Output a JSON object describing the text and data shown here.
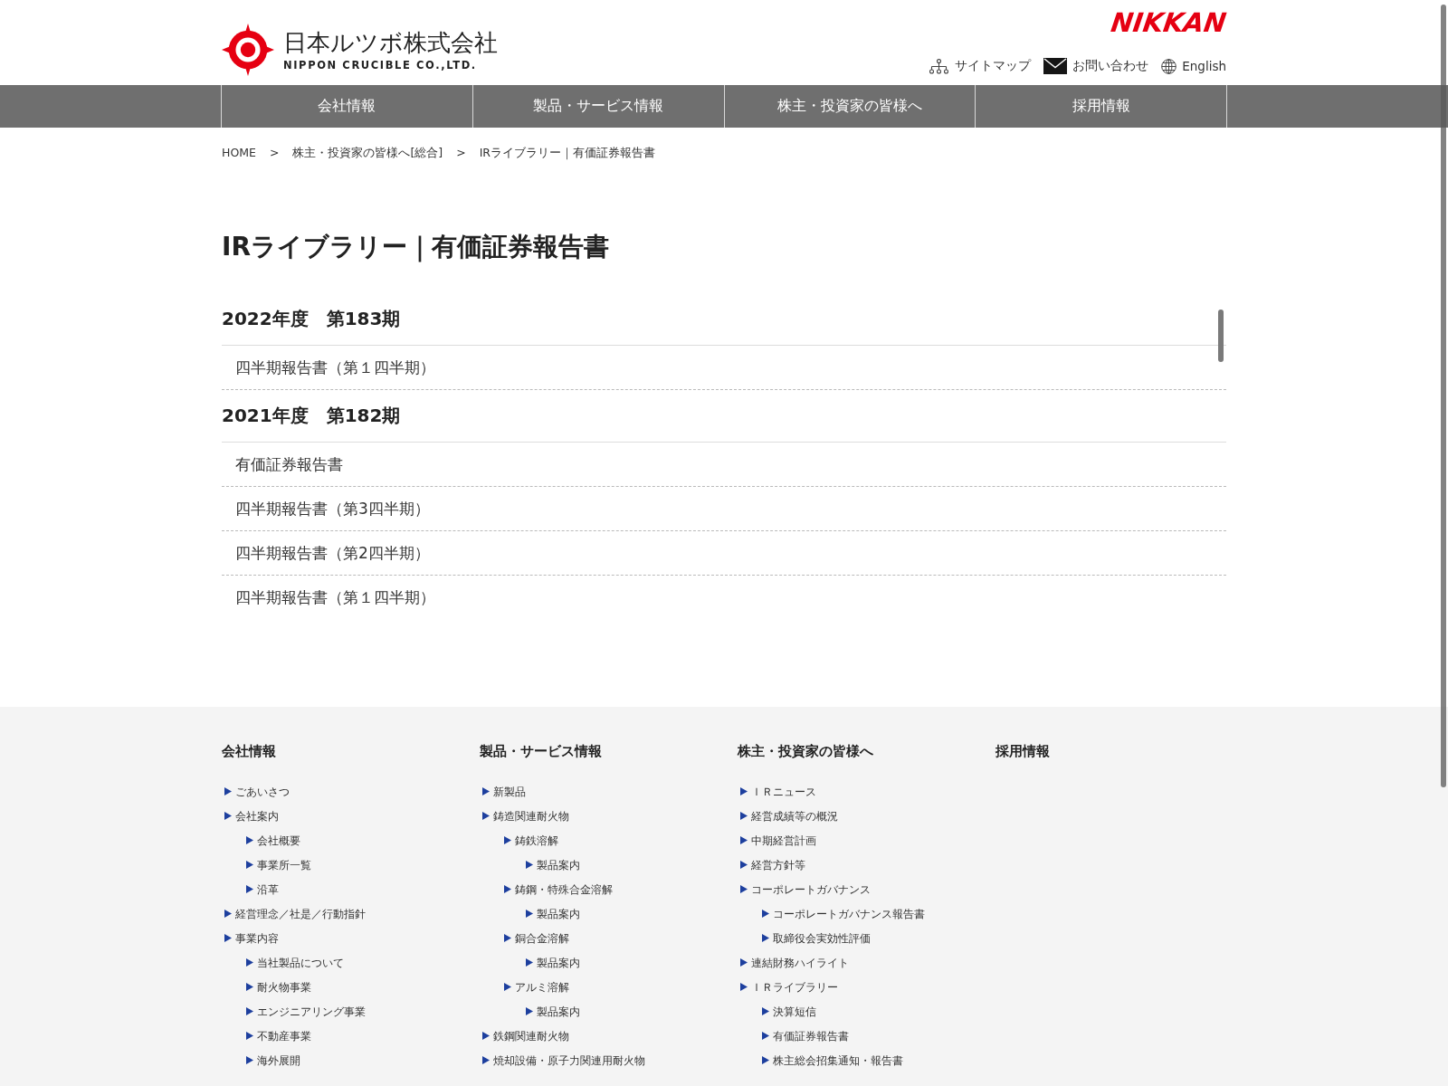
{
  "header": {
    "logo": {
      "name_ja": "日本ルツボ株式会社",
      "name_en": "NIPPON CRUCIBLE CO.,LTD."
    },
    "brand_mark": "NIKKAN",
    "utility_links": [
      {
        "kind": "sitemap",
        "label": "サイトマップ"
      },
      {
        "kind": "mail",
        "label": "お問い合わせ"
      },
      {
        "kind": "globe",
        "label": "English"
      }
    ]
  },
  "nav": [
    {
      "label": "会社情報"
    },
    {
      "label": "製品・サービス情報"
    },
    {
      "label": "株主・投資家の皆様へ"
    },
    {
      "label": "採用情報"
    }
  ],
  "breadcrumb": {
    "separator": ">",
    "items": [
      "HOME",
      "株主・投資家の皆様へ[総合]",
      "IRライブラリー｜有価証券報告書"
    ]
  },
  "page_title": "IRライブラリー｜有価証券報告書",
  "sections": [
    {
      "heading": "2022年度　第183期",
      "documents": [
        "四半期報告書（第１四半期）"
      ]
    },
    {
      "heading": "2021年度　第182期",
      "documents": [
        "有価証券報告書",
        "四半期報告書（第3四半期）",
        "四半期報告書（第2四半期）",
        "四半期報告書（第１四半期）"
      ]
    }
  ],
  "footer": {
    "columns": [
      {
        "heading": "会社情報",
        "links": [
          {
            "label": "ごあいさつ"
          },
          {
            "label": "会社案内",
            "children": [
              {
                "label": "会社概要"
              },
              {
                "label": "事業所一覧"
              },
              {
                "label": "沿革"
              }
            ]
          },
          {
            "label": "経営理念／社是／行動指針"
          },
          {
            "label": "事業内容",
            "children": [
              {
                "label": "当社製品について"
              },
              {
                "label": "耐火物事業"
              },
              {
                "label": "エンジニアリング事業"
              },
              {
                "label": "不動産事業"
              },
              {
                "label": "海外展開"
              }
            ]
          }
        ]
      },
      {
        "heading": "製品・サービス情報",
        "links": [
          {
            "label": "新製品"
          },
          {
            "label": "鋳造関連耐火物",
            "children": [
              {
                "label": "鋳鉄溶解",
                "children": [
                  {
                    "label": "製品案内"
                  }
                ]
              },
              {
                "label": "鋳鋼・特殊合金溶解",
                "children": [
                  {
                    "label": "製品案内"
                  }
                ]
              },
              {
                "label": "銅合金溶解",
                "children": [
                  {
                    "label": "製品案内"
                  }
                ]
              },
              {
                "label": "アルミ溶解",
                "children": [
                  {
                    "label": "製品案内"
                  }
                ]
              }
            ]
          },
          {
            "label": "鉄鋼関連耐火物"
          },
          {
            "label": "焼却設備・原子力関連用耐火物"
          }
        ]
      },
      {
        "heading": "株主・投資家の皆様へ",
        "links": [
          {
            "label": "ＩＲニュース"
          },
          {
            "label": "経営成績等の概況"
          },
          {
            "label": "中期経営計画"
          },
          {
            "label": "経営方針等"
          },
          {
            "label": "コーポレートガバナンス",
            "children": [
              {
                "label": "コーポレートガバナンス報告書"
              },
              {
                "label": "取締役会実効性評価"
              }
            ]
          },
          {
            "label": "連結財務ハイライト"
          },
          {
            "label": "ＩＲライブラリー",
            "children": [
              {
                "label": "決算短信"
              },
              {
                "label": "有価証券報告書"
              },
              {
                "label": "株主総会招集通知・報告書"
              }
            ]
          }
        ]
      },
      {
        "heading": "採用情報"
      }
    ]
  }
}
